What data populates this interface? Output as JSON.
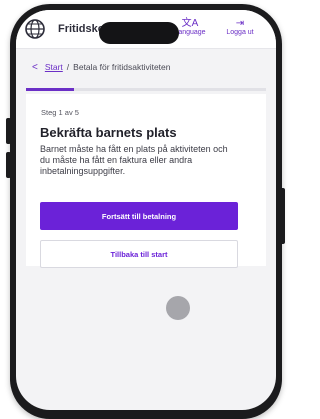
{
  "header": {
    "app_title": "Fritidsko",
    "language_icon": "translate-icon",
    "language_label": "Language",
    "login_icon": "login-icon",
    "login_label": "Logga ut"
  },
  "breadcrumb": {
    "back_icon": "chevron-left-icon",
    "home_label": "Start",
    "separator": "/",
    "current_label": "Betala för fritidsaktiviteten"
  },
  "progress": {
    "current_step": 1,
    "total_steps": 5,
    "fraction": 0.2
  },
  "card": {
    "step_label": "Steg 1 av 5",
    "title": "Bekräfta barnets plats",
    "description": "Barnet måste ha fått en plats på aktiviteten och du måste ha fått en faktura eller andra inbetalningsuppgifter.",
    "primary_button": "Fortsätt till betalning",
    "secondary_button": "Tillbaka till start"
  },
  "colors": {
    "accent": "#6b22d8",
    "background": "#f3f3f5",
    "frame": "#1b1b1d"
  }
}
